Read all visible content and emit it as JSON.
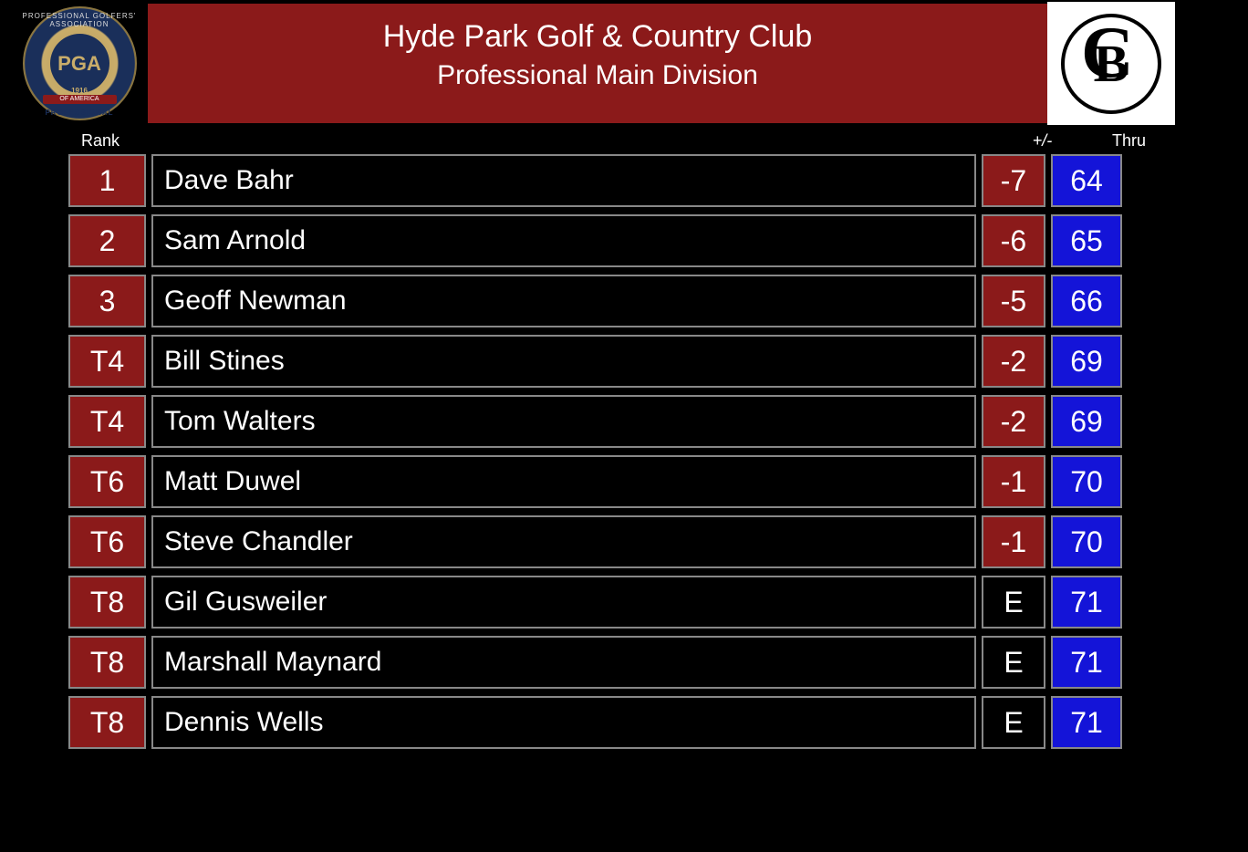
{
  "header": {
    "title": "Hyde Park Golf & Country Club",
    "subtitle": "Professional Main Division",
    "pga": {
      "top_text": "PROFESSIONAL GOLFERS' ASSOCIATION",
      "center": "PGA",
      "year": "1916",
      "ribbon": "OF AMERICA",
      "bottom_text": "PROFESSIONAL"
    }
  },
  "columns": {
    "rank": "Rank",
    "plusminus": "+/-",
    "thru": "Thru"
  },
  "colors": {
    "header_bg": "#8b1a1a",
    "rank_bg": "#8b1a1a",
    "score_bg": "#8b1a1a",
    "thru_bg": "#1414d8",
    "even_bg": "#000000"
  },
  "rows": [
    {
      "rank": "1",
      "name": "Dave Bahr",
      "plusminus": "-7",
      "thru": "64",
      "even": false
    },
    {
      "rank": "2",
      "name": "Sam Arnold",
      "plusminus": "-6",
      "thru": "65",
      "even": false
    },
    {
      "rank": "3",
      "name": "Geoff Newman",
      "plusminus": "-5",
      "thru": "66",
      "even": false
    },
    {
      "rank": "T4",
      "name": "Bill Stines",
      "plusminus": "-2",
      "thru": "69",
      "even": false
    },
    {
      "rank": "T4",
      "name": "Tom Walters",
      "plusminus": "-2",
      "thru": "69",
      "even": false
    },
    {
      "rank": "T6",
      "name": "Matt Duwel",
      "plusminus": "-1",
      "thru": "70",
      "even": false
    },
    {
      "rank": "T6",
      "name": "Steve Chandler",
      "plusminus": "-1",
      "thru": "70",
      "even": false
    },
    {
      "rank": "T8",
      "name": "Gil Gusweiler",
      "plusminus": "E",
      "thru": "71",
      "even": true
    },
    {
      "rank": "T8",
      "name": "Marshall Maynard",
      "plusminus": "E",
      "thru": "71",
      "even": true
    },
    {
      "rank": "T8",
      "name": "Dennis Wells",
      "plusminus": "E",
      "thru": "71",
      "even": true
    }
  ]
}
